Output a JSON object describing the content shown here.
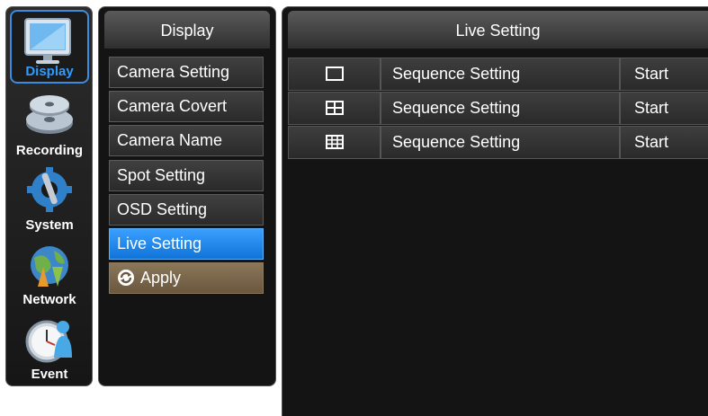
{
  "categories": [
    {
      "label": "Display",
      "icon": "monitor-icon",
      "active": true
    },
    {
      "label": "Recording",
      "icon": "disks-icon",
      "active": false
    },
    {
      "label": "System",
      "icon": "gear-wrench-icon",
      "active": false
    },
    {
      "label": "Network",
      "icon": "globe-arrows-icon",
      "active": false
    },
    {
      "label": "Event",
      "icon": "clock-person-icon",
      "active": false
    }
  ],
  "submenu": {
    "title": "Display",
    "items": [
      {
        "label": "Camera Setting"
      },
      {
        "label": "Camera Covert"
      },
      {
        "label": "Camera Name"
      },
      {
        "label": "Spot Setting"
      },
      {
        "label": "OSD Setting"
      },
      {
        "label": "Live Setting",
        "selected": true
      }
    ],
    "apply_label": "Apply"
  },
  "main": {
    "title": "Live Setting",
    "rows": [
      {
        "layout_icon": "single-screen-icon",
        "label": "Sequence Setting",
        "action": "Start"
      },
      {
        "layout_icon": "quad-screen-icon",
        "label": "Sequence Setting",
        "action": "Start"
      },
      {
        "layout_icon": "nine-screen-icon",
        "label": "Sequence Setting",
        "action": "Start"
      }
    ]
  },
  "colors": {
    "accent": "#2f9bff",
    "selected_bg": "#1f86ec",
    "apply_bg": "#7a6849",
    "panel_bg": "#141414"
  }
}
